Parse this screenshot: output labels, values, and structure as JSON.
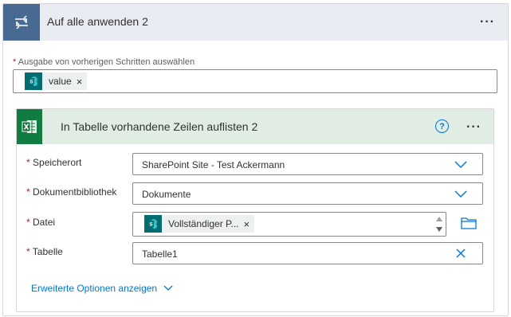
{
  "loop": {
    "title": "Auf alle anwenden 2",
    "menu": "···"
  },
  "previous_output": {
    "required_mark": "*",
    "label": "Ausgabe von vorherigen Schritten auswählen",
    "token_label": "value",
    "token_remove": "×"
  },
  "action": {
    "title": "In Tabelle vorhandene Zeilen auflisten 2",
    "help": "?",
    "menu": "···",
    "fields": {
      "location": {
        "label": "Speicherort",
        "value": "SharePoint Site - Test Ackermann"
      },
      "library": {
        "label": "Dokumentbibliothek",
        "value": "Dokumente"
      },
      "file": {
        "label": "Datei",
        "token_label": "Vollständiger P...",
        "token_remove": "×"
      },
      "table": {
        "label": "Tabelle",
        "value": "Tabelle1"
      }
    },
    "advanced_label": "Erweiterte Optionen anzeigen"
  },
  "colors": {
    "loop_accent": "#486991",
    "excel_accent": "#107c41",
    "sharepoint_accent": "#036c70",
    "link": "#0078d4",
    "required": "#a4262c"
  }
}
